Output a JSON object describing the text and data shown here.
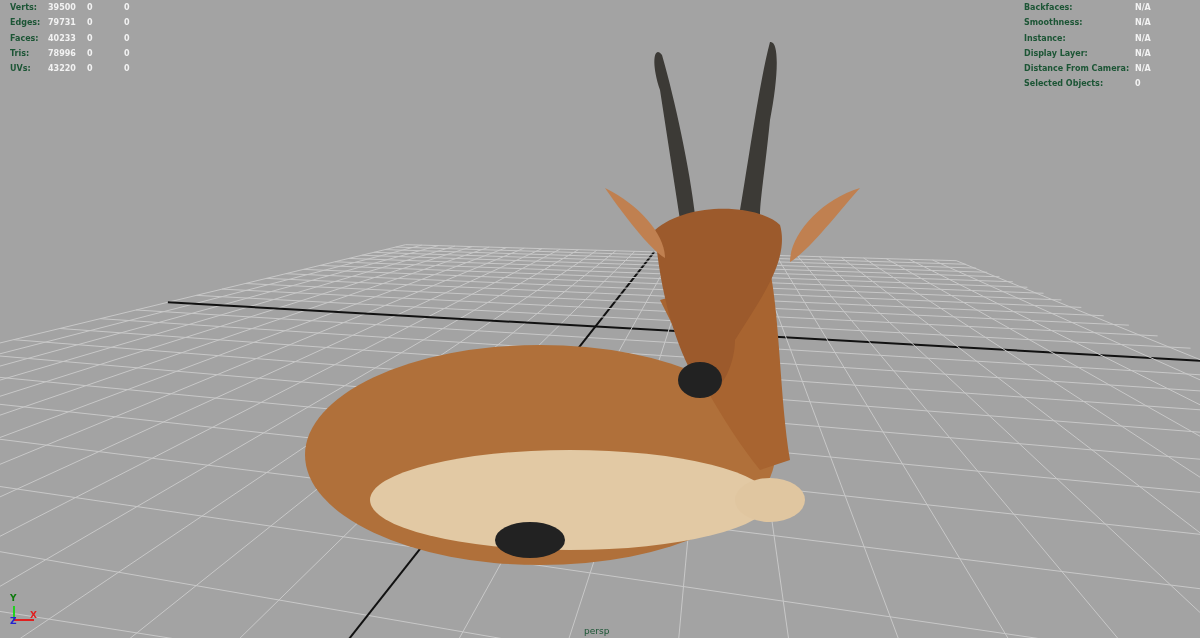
{
  "heads_up_display": {
    "poly_count": [
      {
        "label": "Verts:",
        "values": [
          "39500",
          "0",
          "0"
        ]
      },
      {
        "label": "Edges:",
        "values": [
          "79731",
          "0",
          "0"
        ]
      },
      {
        "label": "Faces:",
        "values": [
          "40233",
          "0",
          "0"
        ]
      },
      {
        "label": "Tris:",
        "values": [
          "78996",
          "0",
          "0"
        ]
      },
      {
        "label": "UVs:",
        "values": [
          "43220",
          "0",
          "0"
        ]
      }
    ],
    "object_details": [
      {
        "label": "Backfaces:",
        "value": "N/A"
      },
      {
        "label": "Smoothness:",
        "value": "N/A"
      },
      {
        "label": "Instance:",
        "value": "N/A"
      },
      {
        "label": "Display Layer:",
        "value": "N/A"
      },
      {
        "label": "Distance From Camera:",
        "value": "N/A"
      },
      {
        "label": "Selected Objects:",
        "value": "0"
      }
    ]
  },
  "axis_gizmo": {
    "y": "Y",
    "z": "Z",
    "x": "X"
  },
  "camera_name": "persp"
}
